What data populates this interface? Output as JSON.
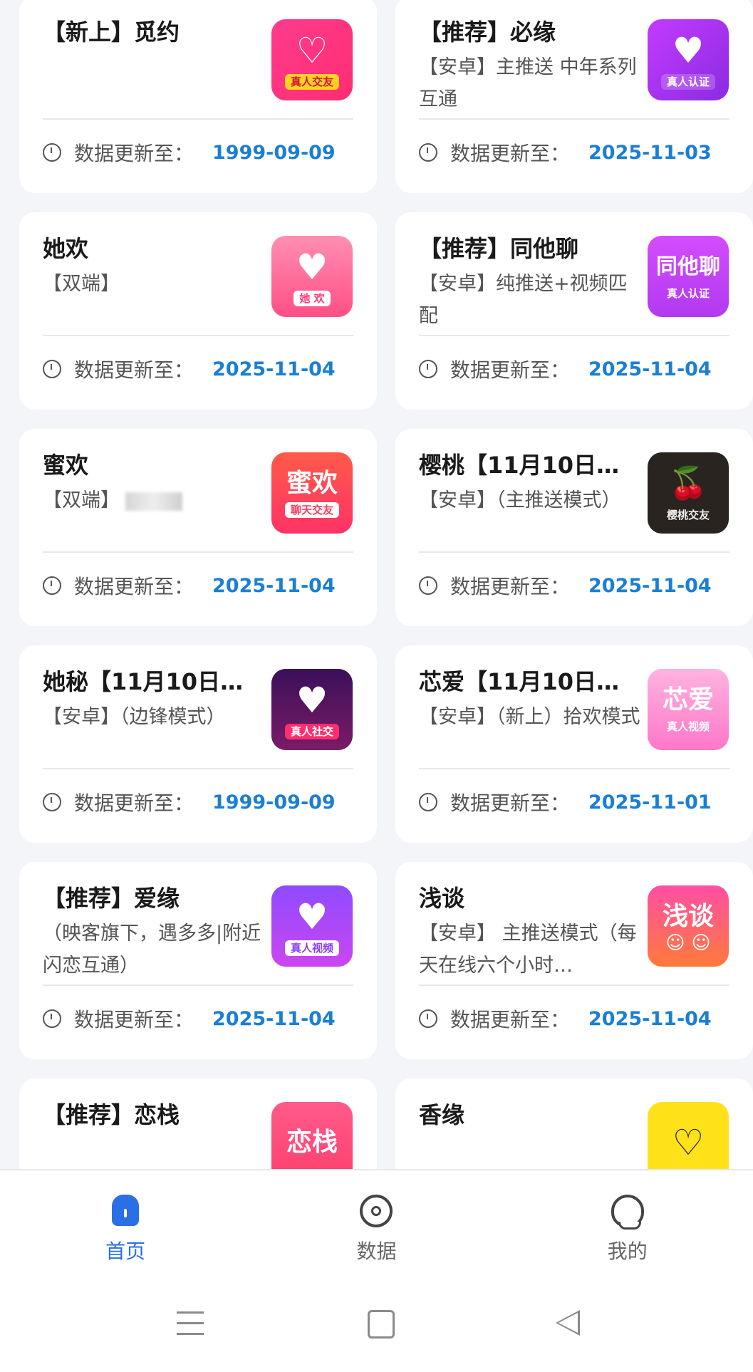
{
  "footer_label": "数据更新至：",
  "cards": [
    {
      "title": "",
      "desc": "",
      "date": "",
      "icon": "partial-card",
      "icon_big": "",
      "icon_small": ""
    },
    {
      "title": "",
      "desc": "",
      "date": "",
      "icon": "partial-card",
      "icon_big": "",
      "icon_small": ""
    },
    {
      "title": "【新上】觅约",
      "desc": "",
      "date": "1999-09-09",
      "icon": "miyue-chat-bubble-icon",
      "icon_big": "♡",
      "icon_small": "真人交友"
    },
    {
      "title": "【推荐】必缘",
      "desc": "【安卓】主推送 中年系列互通",
      "date": "2025-11-03",
      "icon": "biyuan-couple-icon",
      "icon_big": "♥",
      "icon_small": "真人认证"
    },
    {
      "title": "她欢",
      "desc": "【双端】",
      "date": "2025-11-04",
      "icon": "tahuan-hearts-icon",
      "icon_big": "♥",
      "icon_small": "她 欢"
    },
    {
      "title": "【推荐】同他聊",
      "desc": "【安卓】纯推送+视频匹配",
      "date": "2025-11-04",
      "icon": "tongta-text-icon",
      "icon_big": "同他聊",
      "icon_small": "真人认证"
    },
    {
      "title": "蜜欢",
      "desc": "【双端】",
      "date": "2025-11-04",
      "icon": "mihuan-text-icon",
      "icon_big": "蜜欢",
      "icon_small": "聊天交友"
    },
    {
      "title": "樱桃【11月10日…",
      "desc": "【安卓】（主推送模式）",
      "date": "2025-11-04",
      "icon": "cherry-icon",
      "icon_big": "🍒",
      "icon_small": "樱桃交友"
    },
    {
      "title": "她秘【11月10日…",
      "desc": "【安卓】（边锋模式）",
      "date": "1999-09-09",
      "icon": "tami-couple-icon",
      "icon_big": "♥",
      "icon_small": "真人社交"
    },
    {
      "title": "芯爱【11月10日…",
      "desc": "【安卓】（新上）拾欢模式",
      "date": "2025-11-01",
      "icon": "xinai-text-icon",
      "icon_big": "芯爱",
      "icon_small": "真人视频"
    },
    {
      "title": "【推荐】爱缘",
      "desc": "（映客旗下，遇多多|附近闪恋互通）",
      "date": "2025-11-04",
      "icon": "aiyuan-couple-icon",
      "icon_big": "♥",
      "icon_small": "真人视频"
    },
    {
      "title": "浅谈",
      "desc": "【安卓】 主推送模式（每天在线六个小时…",
      "date": "2025-11-04",
      "icon": "qiantan-faces-icon",
      "icon_big": "浅谈",
      "icon_small": "☺ ☺"
    },
    {
      "title": "【推荐】恋栈",
      "desc": "",
      "date": "",
      "icon": "lianzhan-text-icon",
      "icon_big": "恋栈",
      "icon_small": ""
    },
    {
      "title": "香缘",
      "desc": "",
      "date": "",
      "icon": "xiangyuan-heart-icon",
      "icon_big": "♡",
      "icon_small": ""
    }
  ],
  "tabs": [
    {
      "label": "首页",
      "icon": "home-icon",
      "active": true
    },
    {
      "label": "数据",
      "icon": "data-icon",
      "active": false
    },
    {
      "label": "我的",
      "icon": "profile-icon",
      "active": false
    }
  ],
  "system_nav": [
    "menu-icon",
    "home-square-icon",
    "back-triangle-icon"
  ]
}
